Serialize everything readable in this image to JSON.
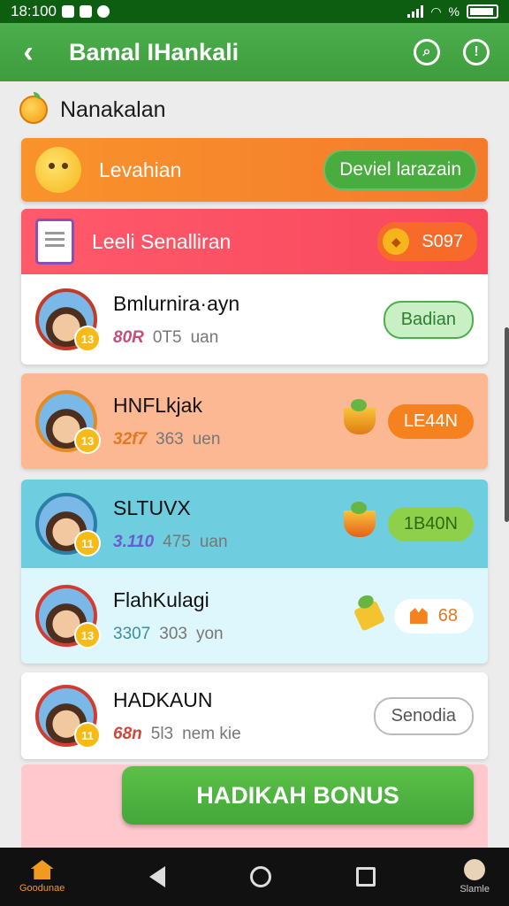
{
  "status": {
    "time": "18:100",
    "battery_text": "%"
  },
  "appbar": {
    "title": "Bamal ⁠IHankali"
  },
  "section": {
    "title": "Nanakalan"
  },
  "banner1": {
    "text": "Levahian",
    "button": "Deviel larazain"
  },
  "banner2": {
    "text": "Leeli Senalliran",
    "badge": "S097"
  },
  "rows": [
    {
      "name": "Bmlurnira·ayn",
      "price": "80R",
      "count": "0T5",
      "unit": "uan",
      "button": "Badian",
      "badge": "13",
      "price_color": "#c2507a"
    },
    {
      "name": "HNFLkjak",
      "price": "32f7",
      "count": "363",
      "unit": "uen",
      "button": "LE44N",
      "badge": "13",
      "price_color": "#e07a22"
    },
    {
      "name": "SLTUVX",
      "price": "3.110",
      "count": "475",
      "unit": "uan",
      "button": "1B40N",
      "badge": "11",
      "price_color": "#6e5ad0"
    },
    {
      "name": "FlahKulagi",
      "price": "3307",
      "count": "303",
      "unit": "yon",
      "button": "68",
      "badge": "13",
      "price_color": "#3c8f9a"
    },
    {
      "name": "HADKAUN",
      "price": "68n",
      "count": "5l3",
      "unit": "nem kie",
      "button": "Senodia",
      "badge": "11",
      "price_color": "#d1483a"
    }
  ],
  "bonus": {
    "label": "HADIKAH BONUS"
  },
  "nav": {
    "home_label": "Goodunae",
    "profile_label": "Slamle"
  },
  "colors": {
    "green": "#4cae4c",
    "orange": "#f7832b",
    "pink": "#f8475c"
  }
}
